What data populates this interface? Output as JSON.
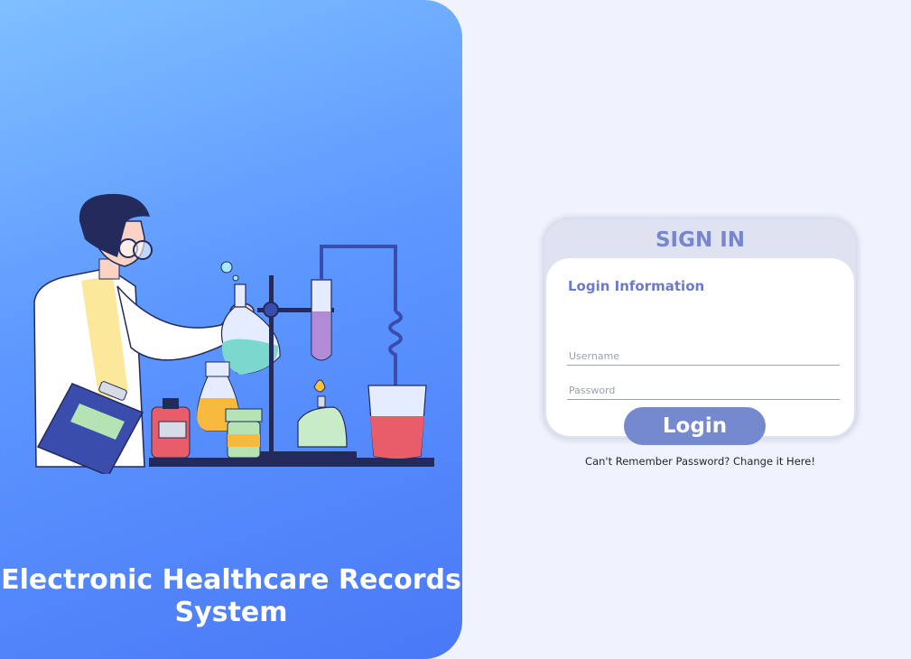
{
  "branding": {
    "title_line1": "Electronic Healthcare Records",
    "title_line2": "System"
  },
  "illustration": {
    "name": "scientist-lab-illustration"
  },
  "login_card": {
    "heading": "SIGN IN",
    "section_label": "Login Information",
    "username_placeholder": "Username",
    "password_placeholder": "Password",
    "login_button": "Login",
    "forgot_link": "Can't Remember Password? Change it Here!"
  },
  "colors": {
    "left_gradient_start": "#7ec0ff",
    "left_gradient_end": "#4a78f7",
    "page_background": "#f0f3fd",
    "accent": "#7589cf",
    "heading": "#7786cf"
  }
}
